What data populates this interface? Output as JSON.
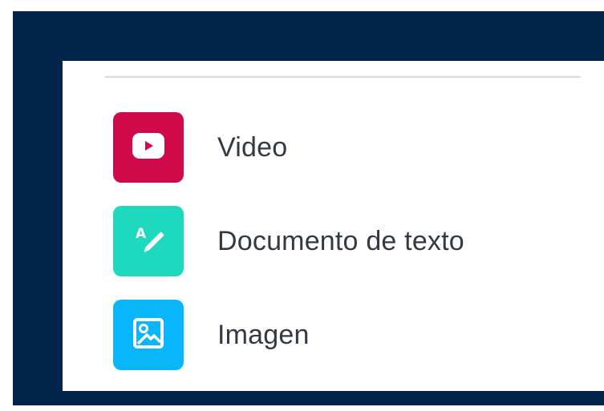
{
  "menu": {
    "items": [
      {
        "label": "Video",
        "icon": "video-play-icon",
        "color": "#cf0a4a"
      },
      {
        "label": "Documento de texto",
        "icon": "text-document-pen-icon",
        "color": "#1ed9bd"
      },
      {
        "label": "Imagen",
        "icon": "image-icon",
        "color": "#08b6f9"
      }
    ]
  },
  "colors": {
    "frame_background": "#03254c",
    "panel_background": "#ffffff",
    "divider": "#d7d9df",
    "text": "#333a42"
  }
}
